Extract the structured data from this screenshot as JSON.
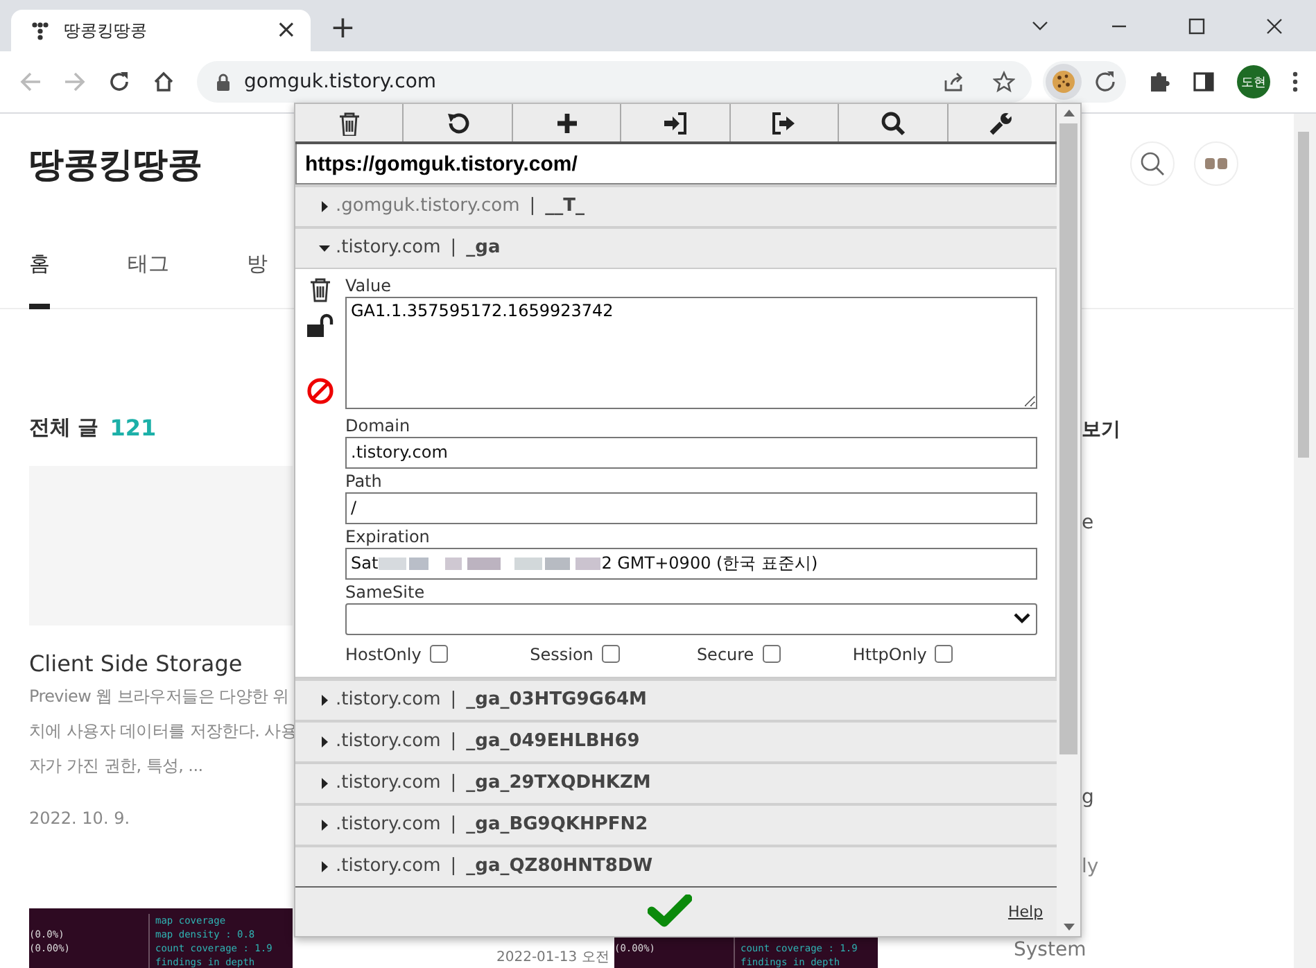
{
  "browser": {
    "tab": {
      "title": "땅콩킹땅콩",
      "close": "×"
    },
    "new_tab": "+",
    "address": "gomguk.tistory.com",
    "profile": "도현"
  },
  "page": {
    "blog_title": "땅콩킹땅콩",
    "nav": [
      {
        "label": "홈",
        "selected": true
      },
      {
        "label": "태그",
        "selected": false
      },
      {
        "label": "방",
        "selected": false
      }
    ],
    "section": {
      "title": "전체 글",
      "count": "121"
    },
    "post": {
      "title": "Client Side Storage",
      "excerpt": "Preview 웹 브라우저들은 다양한 위치에 사용자 데이터를 저장한다. 사용자가 가진 권한, 특성, ...",
      "date": "2022. 10. 9."
    },
    "thumbnails": [
      {
        "rows": [
          {
            "right": "map coverage"
          },
          {
            "left": "(0.0%)",
            "right": "map density : 0.8"
          },
          {
            "left": "(0.00%)",
            "right": "count coverage : 1.9"
          },
          {
            "right": "findings in depth"
          }
        ]
      },
      {
        "rows": [
          {},
          {},
          {
            "left": "(0.00%)",
            "right": "count coverage : 1.9"
          },
          {
            "right": "findings in depth"
          }
        ]
      }
    ],
    "second_date": "2022-01-13 오전",
    "sidebar_fragments": [
      "보기",
      "e",
      "g",
      "ly",
      "System"
    ]
  },
  "popup": {
    "url": "https://gomguk.tistory.com/",
    "cookies": [
      {
        "domain": ".gomguk.tistory.com",
        "separator": "|",
        "name": "__T_",
        "expanded": false
      },
      {
        "domain": ".tistory.com",
        "separator": "|",
        "name": "_ga",
        "expanded": true,
        "editor": {
          "value_label": "Value",
          "value": "GA1.1.357595172.1659923742",
          "domain_label": "Domain",
          "domain": ".tistory.com",
          "path_label": "Path",
          "path": "/",
          "expiration_label": "Expiration",
          "expiration_start": "Sat",
          "expiration_end": "2 GMT+0900 (한국 표준시)",
          "samesite_label": "SameSite",
          "flags": [
            {
              "label": "HostOnly",
              "checked": false
            },
            {
              "label": "Session",
              "checked": false
            },
            {
              "label": "Secure",
              "checked": false
            },
            {
              "label": "HttpOnly",
              "checked": false
            }
          ]
        }
      },
      {
        "domain": ".tistory.com",
        "separator": "|",
        "name": "_ga_03HTG9G64M",
        "expanded": false
      },
      {
        "domain": ".tistory.com",
        "separator": "|",
        "name": "_ga_049EHLBH69",
        "expanded": false
      },
      {
        "domain": ".tistory.com",
        "separator": "|",
        "name": "_ga_29TXQDHKZM",
        "expanded": false
      },
      {
        "domain": ".tistory.com",
        "separator": "|",
        "name": "_ga_BG9QKHPFN2",
        "expanded": false
      },
      {
        "domain": ".tistory.com",
        "separator": "|",
        "name": "_ga_QZ80HNT8DW",
        "expanded": false
      }
    ],
    "help": "Help"
  }
}
